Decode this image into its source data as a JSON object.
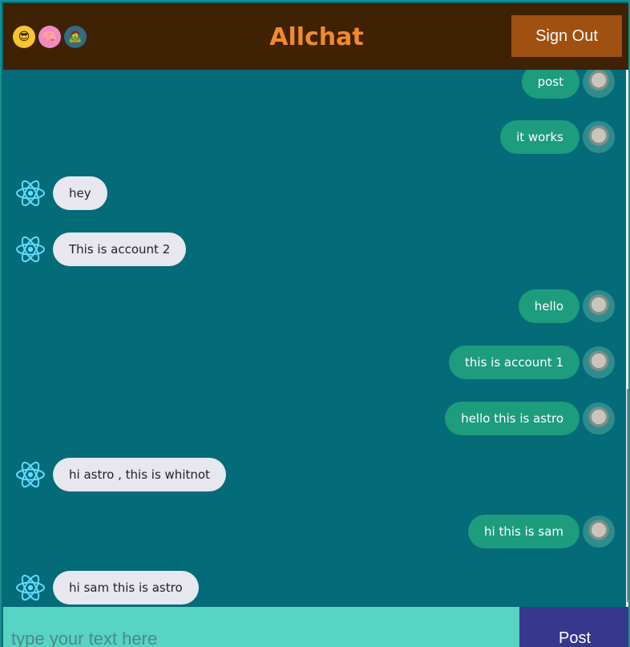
{
  "header": {
    "title": "Allchat",
    "signout_label": "Sign Out",
    "emojis": [
      "😎",
      "🧠",
      "🧟"
    ],
    "colors": {
      "bar": "#3f2203",
      "title": "#f08a2c",
      "signout": "#a05010"
    }
  },
  "messages": [
    {
      "side": "sent",
      "text": "post"
    },
    {
      "side": "sent",
      "text": "it works"
    },
    {
      "side": "received",
      "text": "hey"
    },
    {
      "side": "received",
      "text": "This is account 2"
    },
    {
      "side": "sent",
      "text": "hello"
    },
    {
      "side": "sent",
      "text": "this is account 1"
    },
    {
      "side": "sent",
      "text": "hello this is astro"
    },
    {
      "side": "received",
      "text": "hi astro , this is whitnot"
    },
    {
      "side": "sent",
      "text": "hi this is sam"
    },
    {
      "side": "received",
      "text": "hi sam this is astro"
    }
  ],
  "composer": {
    "placeholder": "type your text here",
    "post_label": "Post"
  },
  "icons": {
    "sent_avatar": "user-avatar-statue-icon",
    "received_avatar": "react-atom-icon"
  },
  "colors": {
    "background": "#046b78",
    "sent_bubble": "#1d9c7e",
    "received_bubble": "#e7e7ef",
    "input": "#57d4c3",
    "post_button": "#38378e"
  }
}
